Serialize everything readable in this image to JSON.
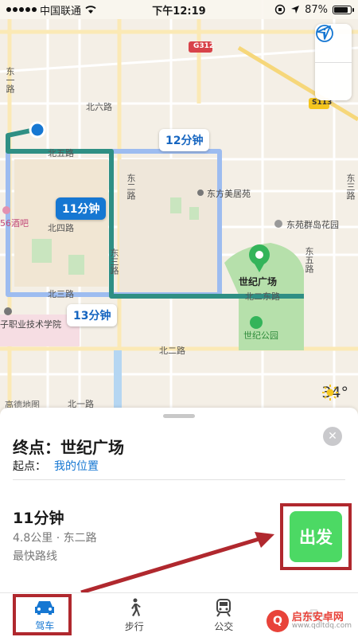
{
  "status_bar": {
    "carrier": "中国联通",
    "time": "下午12:19",
    "battery": "87%",
    "battery_fraction": 0.87
  },
  "map": {
    "roads": [
      "北六路",
      "北五路",
      "北四路",
      "北三路",
      "北二路",
      "北一路",
      "东一路",
      "东二路",
      "东三路",
      "东五路",
      "东三路",
      "北二东路"
    ],
    "road_badges": [
      "G312",
      "S113"
    ],
    "pois": [
      "东方美居苑",
      "东苑群岛花园",
      "世纪广场",
      "世纪公园",
      "56酒吧",
      "子职业技术学院"
    ],
    "route_times": {
      "route_a": "12分钟",
      "route_b": "11分钟",
      "route_c": "13分钟"
    },
    "legal": "高德地图",
    "weather": "34°",
    "controls": {
      "info_icon": "info-icon",
      "locate_icon": "location-arrow-icon"
    },
    "colors": {
      "route_selected": "#2f8f84",
      "route_alt": "#9dbcf0",
      "park": "#b6e0ab",
      "pin": "#34b45a"
    }
  },
  "sheet": {
    "destination_label": "终点：世纪广场",
    "origin_label": "起点：",
    "origin_value": "我的位置",
    "eta": "11分钟",
    "distance": "4.8公里 · 东二路",
    "route_type": "最快路线",
    "go_label": "出发",
    "colors": {
      "go": "#4cd964",
      "highlight": "#b0282e"
    }
  },
  "tabs": [
    {
      "label": "驾车",
      "icon": "car-icon",
      "active": true
    },
    {
      "label": "步行",
      "icon": "walk-icon",
      "active": false
    },
    {
      "label": "公交",
      "icon": "train-icon",
      "active": false
    },
    {
      "label": "",
      "icon": "bike-icon",
      "active": false
    }
  ],
  "watermark": {
    "title": "启东安卓网",
    "url": "www.qdltdq.com"
  }
}
